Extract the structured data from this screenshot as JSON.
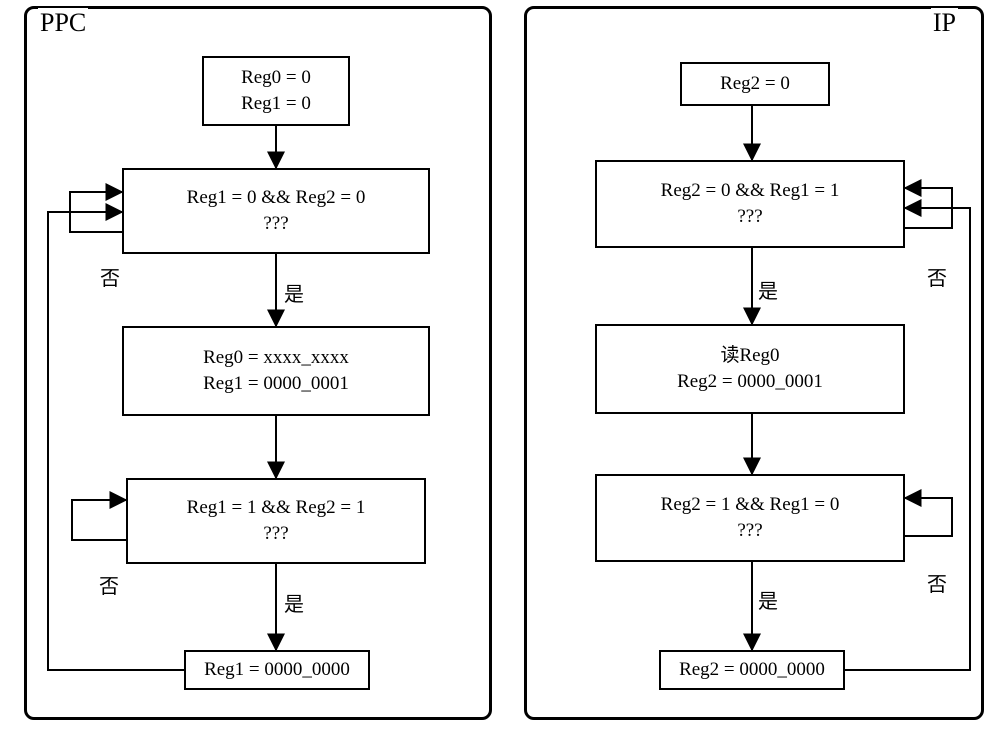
{
  "left": {
    "title": "PPC",
    "init": {
      "l1": "Reg0 = 0",
      "l2": "Reg1 = 0"
    },
    "cond1": {
      "l1": "Reg1 = 0  &&  Reg2 = 0",
      "l2": "???"
    },
    "assign1": {
      "l1": "Reg0 = xxxx_xxxx",
      "l2": "Reg1 = 0000_0001"
    },
    "cond2": {
      "l1": "Reg1 = 1  &&  Reg2 = 1",
      "l2": "???"
    },
    "final": "Reg1 = 0000_0000",
    "yes": "是",
    "no": "否"
  },
  "right": {
    "title": "IP",
    "init": "Reg2 = 0",
    "cond1": {
      "l1": "Reg2 = 0  &&  Reg1 = 1",
      "l2": "???"
    },
    "assign1": {
      "l1": "读Reg0",
      "l2": "Reg2 = 0000_0001"
    },
    "cond2": {
      "l1": "Reg2 = 1  &&  Reg1 = 0",
      "l2": "???"
    },
    "final": "Reg2 = 0000_0000",
    "yes": "是",
    "no": "否"
  }
}
